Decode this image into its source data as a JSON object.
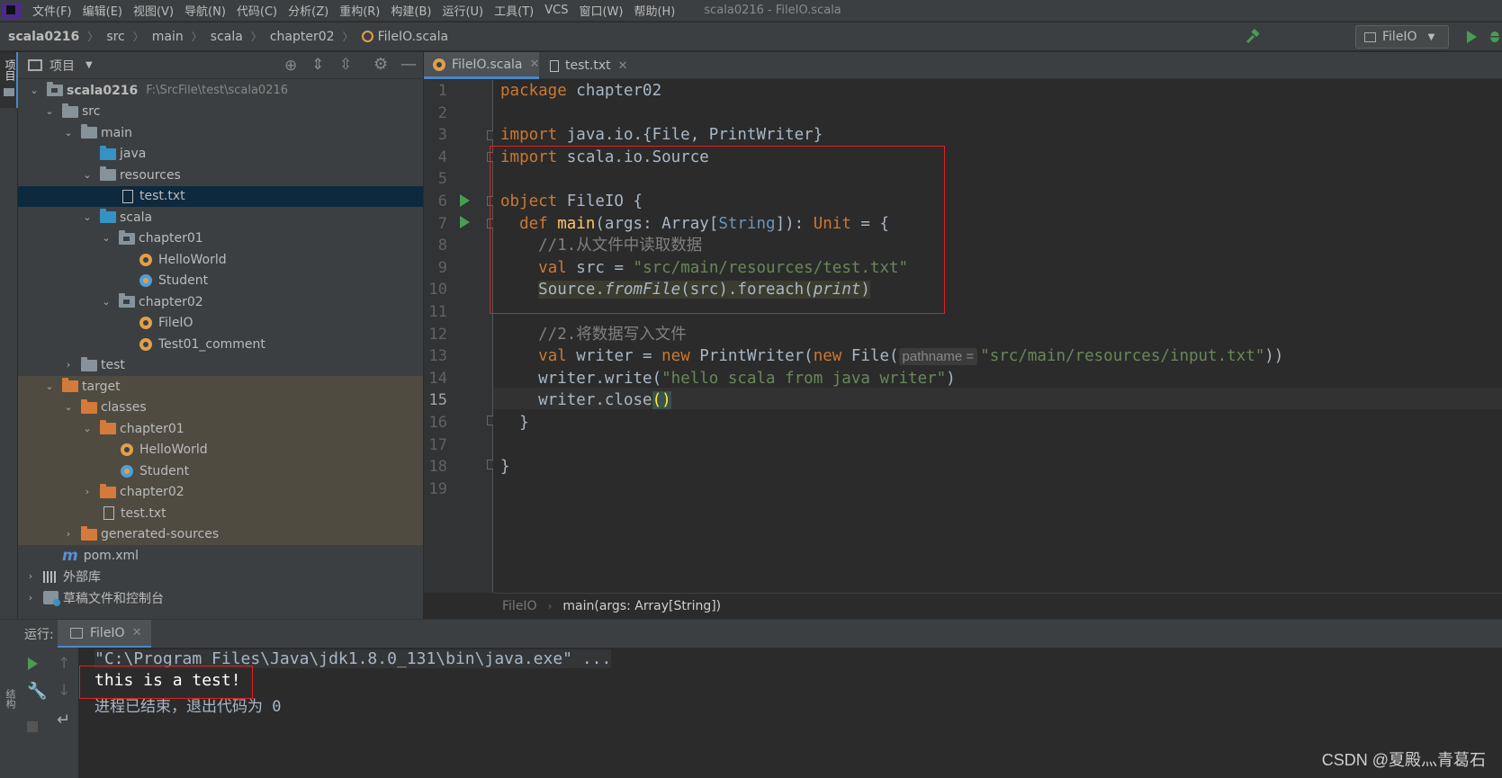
{
  "menubar": {
    "items": [
      "文件(F)",
      "编辑(E)",
      "视图(V)",
      "导航(N)",
      "代码(C)",
      "分析(Z)",
      "重构(R)",
      "构建(B)",
      "运行(U)",
      "工具(T)",
      "VCS",
      "窗口(W)",
      "帮助(H)"
    ],
    "window_title": "scala0216 - FileIO.scala"
  },
  "breadcrumb": {
    "items": [
      "scala0216",
      "src",
      "main",
      "scala",
      "chapter02",
      "FileIO.scala"
    ]
  },
  "run_config": {
    "label": "FileIO"
  },
  "left_stripe": {
    "label": "项目"
  },
  "project_panel": {
    "title": "项目",
    "tree": [
      {
        "label": "scala0216",
        "path": "F:\\SrcFile\\test\\scala0216"
      },
      {
        "label": "src"
      },
      {
        "label": "main"
      },
      {
        "label": "java"
      },
      {
        "label": "resources"
      },
      {
        "label": "test.txt"
      },
      {
        "label": "scala"
      },
      {
        "label": "chapter01"
      },
      {
        "label": "HelloWorld"
      },
      {
        "label": "Student"
      },
      {
        "label": "chapter02"
      },
      {
        "label": "FileIO"
      },
      {
        "label": "Test01_comment"
      },
      {
        "label": "test"
      },
      {
        "label": "target"
      },
      {
        "label": "classes"
      },
      {
        "label": "chapter01"
      },
      {
        "label": "HelloWorld"
      },
      {
        "label": "Student"
      },
      {
        "label": "chapter02"
      },
      {
        "label": "test.txt"
      },
      {
        "label": "generated-sources"
      },
      {
        "label": "pom.xml"
      },
      {
        "label": "外部库"
      },
      {
        "label": "草稿文件和控制台"
      }
    ]
  },
  "editor": {
    "tabs": [
      {
        "label": "FileIO.scala"
      },
      {
        "label": "test.txt"
      }
    ],
    "line_numbers": [
      "1",
      "2",
      "3",
      "4",
      "5",
      "6",
      "7",
      "8",
      "9",
      "10",
      "11",
      "12",
      "13",
      "14",
      "15",
      "16",
      "17",
      "18",
      "19"
    ],
    "current_line": "15",
    "code": {
      "l1_kw": "package",
      "l1_rest": " chapter02",
      "l3_kw": "import",
      "l3_rest": " java.io.{File, PrintWriter}",
      "l4_kw": "import",
      "l4_rest": " scala.io.Source",
      "l6_kw": "object",
      "l6_rest": " FileIO {",
      "l7_indent": "  ",
      "l7_kw": "def",
      "l7_sp": " ",
      "l7_fn": "main",
      "l7_a": "(args: Array[",
      "l7_type": "String",
      "l7_b": "]): ",
      "l7_unit": "Unit",
      "l7_c": " = {",
      "l8_comment": "    //1.从文件中读取数据",
      "l9_indent": "    ",
      "l9_kw": "val",
      "l9_mid": " src = ",
      "l9_str": "\"src/main/resources/test.txt\"",
      "l10_indent": "    ",
      "l10_a": "Source.",
      "l10_fn": "fromFile",
      "l10_b": "(src).foreach(",
      "l10_arg": "print",
      "l10_c": ")",
      "l12_comment": "    //2.将数据写入文件",
      "l13_indent": "    ",
      "l13_kw": "val",
      "l13_mid": " writer = ",
      "l13_new": "new",
      "l13_b": " PrintWriter(",
      "l13_new2": "new",
      "l13_c": " File(",
      "l13_hint": "pathname =",
      "l13_str": "\"src/main/resources/input.txt\"",
      "l13_d": "))",
      "l14_a": "    writer.write(",
      "l14_str": "\"hello scala from java writer\"",
      "l14_b": ")",
      "l15_a": "    writer.close",
      "l15_brace": "()",
      "l16": "  }",
      "l18": "}"
    },
    "breadcrumb": [
      "FileIO",
      "main(args: Array[String])"
    ]
  },
  "run_panel": {
    "label": "运行:",
    "tab": "FileIO",
    "side_label": "结构",
    "output": [
      "\"C:\\Program Files\\Java\\jdk1.8.0_131\\bin\\java.exe\" ...",
      "this is a test!",
      "进程已结束，退出代码为 0"
    ]
  },
  "watermark": "CSDN @夏殿灬青葛石",
  "colors": {
    "keyword": "#cc7832",
    "string": "#6a8759",
    "comment": "#808080",
    "function": "#ffc66d",
    "selection": "#0d293e",
    "highlight_box": "#e02020"
  }
}
